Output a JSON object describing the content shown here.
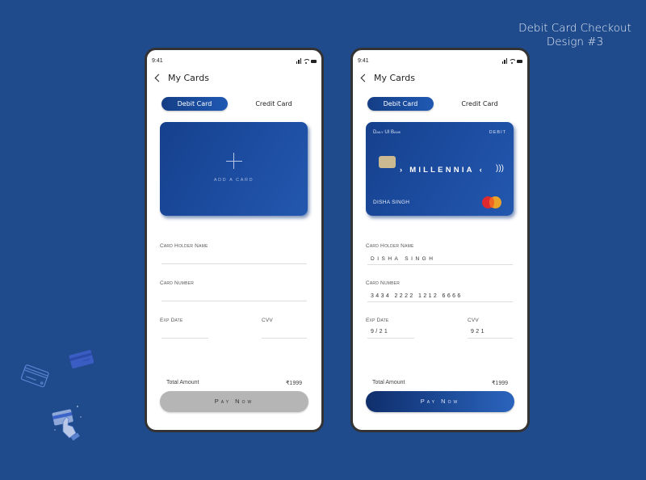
{
  "page_title": {
    "line1": "Debit Card Checkout",
    "line2": "Design #3"
  },
  "phones": [
    {
      "status": {
        "time": "9:41"
      },
      "header": {
        "title": "My Cards",
        "back_icon": "chevron-left-icon"
      },
      "tabs": [
        {
          "label": "Debit Card",
          "active": true
        },
        {
          "label": "Credit Card",
          "active": false
        }
      ],
      "card": {
        "state": "empty",
        "add_label": "ADD A CARD",
        "icon": "plus-icon"
      },
      "form": {
        "holder": {
          "label": "Card Holder Name",
          "value": ""
        },
        "number": {
          "label": "Card Number",
          "value": ""
        },
        "exp": {
          "label": "Exp Date",
          "value": ""
        },
        "cvv": {
          "label": "CVV",
          "value": ""
        }
      },
      "total": {
        "label": "Total Amount",
        "value": "₹1999"
      },
      "pay": {
        "label": "Pay Now",
        "enabled": false
      }
    },
    {
      "status": {
        "time": "9:41"
      },
      "header": {
        "title": "My Cards",
        "back_icon": "chevron-left-icon"
      },
      "tabs": [
        {
          "label": "Debit Card",
          "active": true
        },
        {
          "label": "Credit Card",
          "active": false
        }
      ],
      "card": {
        "state": "filled",
        "bank": "Daily UI Bank",
        "type": "DEBIT",
        "brand": "MILLENNIA",
        "holder": "DISHA SINGH",
        "network_icon": "mastercard-icon"
      },
      "form": {
        "holder": {
          "label": "Card Holder Name",
          "value": "DISHA SINGH"
        },
        "number": {
          "label": "Card Number",
          "value": "3434 2222 1212 6666"
        },
        "exp": {
          "label": "Exp Date",
          "value": "9/21"
        },
        "cvv": {
          "label": "CVV",
          "value": "921"
        }
      },
      "total": {
        "label": "Total Amount",
        "value": "₹1999"
      },
      "pay": {
        "label": "Pay Now",
        "enabled": true
      }
    }
  ],
  "colors": {
    "background": "#1f4a8c",
    "accent": "#1d4ea3",
    "disabled_button": "#b5b5b5"
  }
}
